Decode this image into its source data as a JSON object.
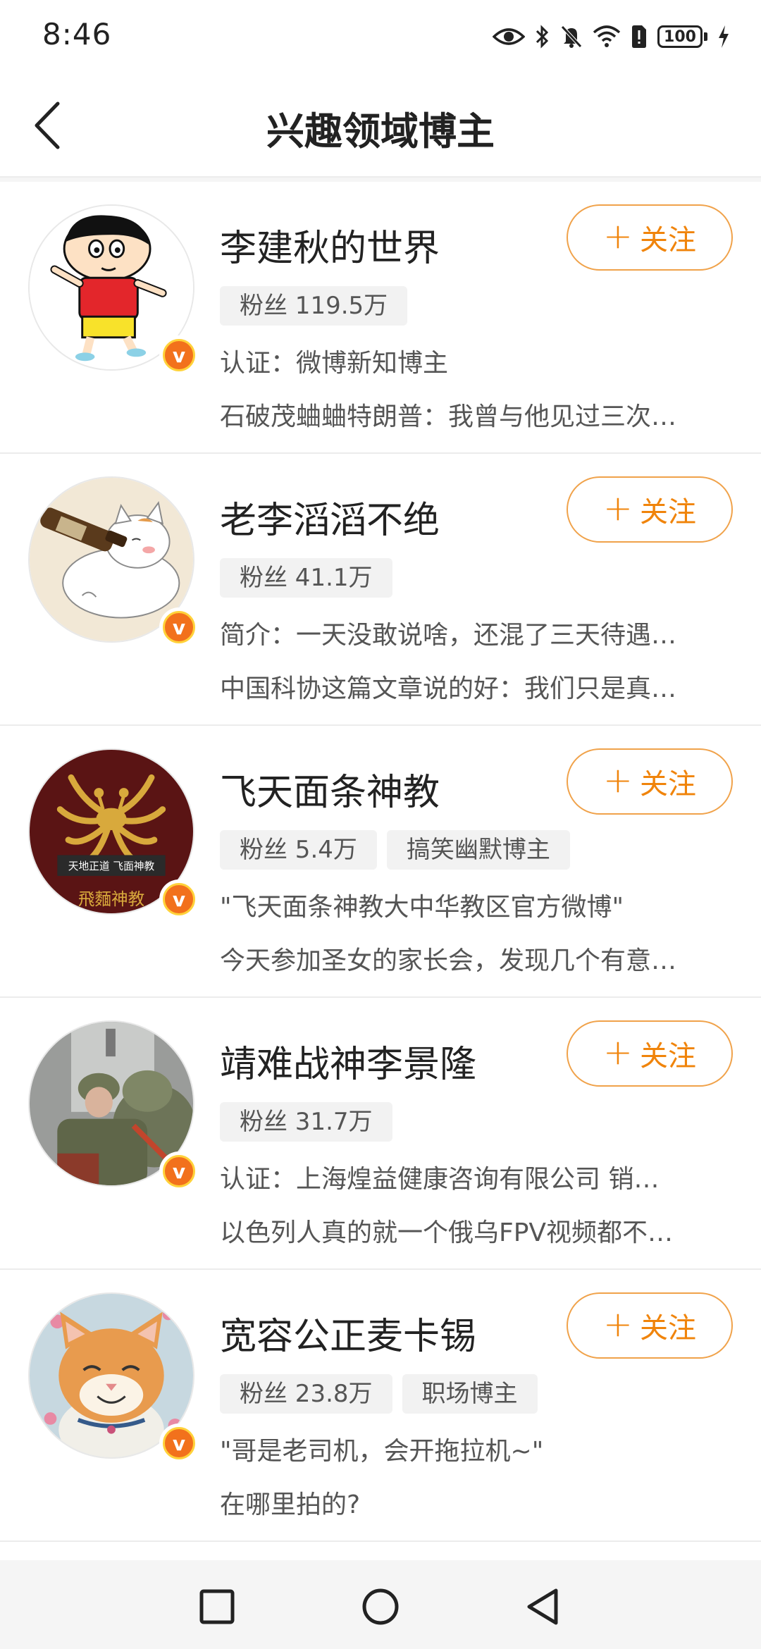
{
  "status": {
    "time": "8:46",
    "battery": "100"
  },
  "header": {
    "title": "兴趣领域博主"
  },
  "follow_label": "关注",
  "bloggers": [
    {
      "name": "李建秋的世界",
      "fans": "粉丝 119.5万",
      "category": "",
      "line1": "认证：微博新知博主",
      "line2": "石破茂蛐蛐特朗普：我曾与他见过三次…",
      "avatar": "crayon-shin-chan-avatar"
    },
    {
      "name": "老李滔滔不绝",
      "fans": "粉丝 41.1万",
      "category": "",
      "line1": "简介：一天没敢说啥，还混了三天待遇…",
      "line2": "中国科协这篇文章说的好：我们只是真…",
      "avatar": "cat-with-bottle-avatar"
    },
    {
      "name": "飞天面条神教",
      "fans": "粉丝 5.4万",
      "category": "搞笑幽默博主",
      "line1": "\"飞天面条神教大中华教区官方微博\"",
      "line2": "今天参加圣女的家长会，发现几个有意…",
      "avatar": "flying-spaghetti-monster-avatar",
      "avatar_text": "天地正道 飞面神教"
    },
    {
      "name": "靖难战神李景隆",
      "fans": "粉丝 31.7万",
      "category": "",
      "line1": "认证：上海煌益健康咨询有限公司 销…",
      "line2": "以色列人真的就一个俄乌FPV视频都不…",
      "avatar": "soldier-photo-avatar"
    },
    {
      "name": "宽容公正麦卡锡",
      "fans": "粉丝 23.8万",
      "category": "职场博主",
      "line1": "\"哥是老司机，会开拖拉机~\"",
      "line2": "在哪里拍的?",
      "avatar": "smiling-cat-avatar"
    }
  ],
  "colors": {
    "accent": "#f0840b",
    "badge": "#f2711c"
  }
}
